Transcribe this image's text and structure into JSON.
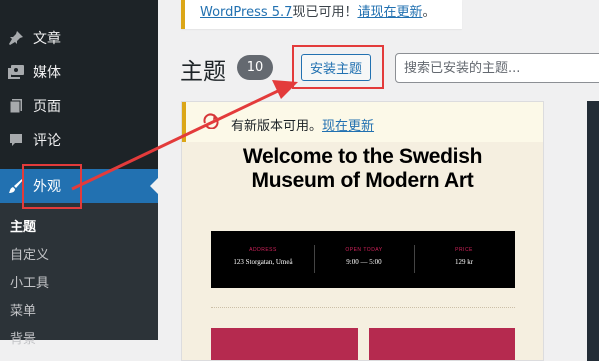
{
  "sidebar": {
    "items": [
      {
        "label": "文章",
        "icon": "pushpin-icon"
      },
      {
        "label": "媒体",
        "icon": "media-icon"
      },
      {
        "label": "页面",
        "icon": "page-icon"
      },
      {
        "label": "评论",
        "icon": "comment-icon"
      },
      {
        "label": "外观",
        "icon": "appearance-brush-icon"
      }
    ],
    "submenu": [
      "主题",
      "自定义",
      "小工具",
      "菜单",
      "背景"
    ]
  },
  "update_notice": {
    "link1": "WordPress 5.7",
    "text": "现已可用！",
    "link2": "请现在更新",
    "end": "。"
  },
  "header": {
    "title": "主题",
    "count": "10",
    "add_new": "安装主题",
    "search_placeholder": "搜索已安装的主题..."
  },
  "theme_card": {
    "notice_text": "有新版本可用。",
    "notice_link": "现在更新",
    "screenshot": {
      "title_line1": "Welcome to the Swedish",
      "title_line2": "Museum of Modern Art",
      "info": [
        {
          "key": "ADDRESS",
          "value": "123 Storgatan, Umeå"
        },
        {
          "key": "OPEN TODAY",
          "value": "9:00 — 5:00"
        },
        {
          "key": "PRICE",
          "value": "129 kr"
        }
      ]
    }
  },
  "colors": {
    "sidebar_bg": "#1d2327",
    "accent": "#2271b1",
    "annotation": "#e33b3b",
    "notice_yellow": "#dba617"
  }
}
